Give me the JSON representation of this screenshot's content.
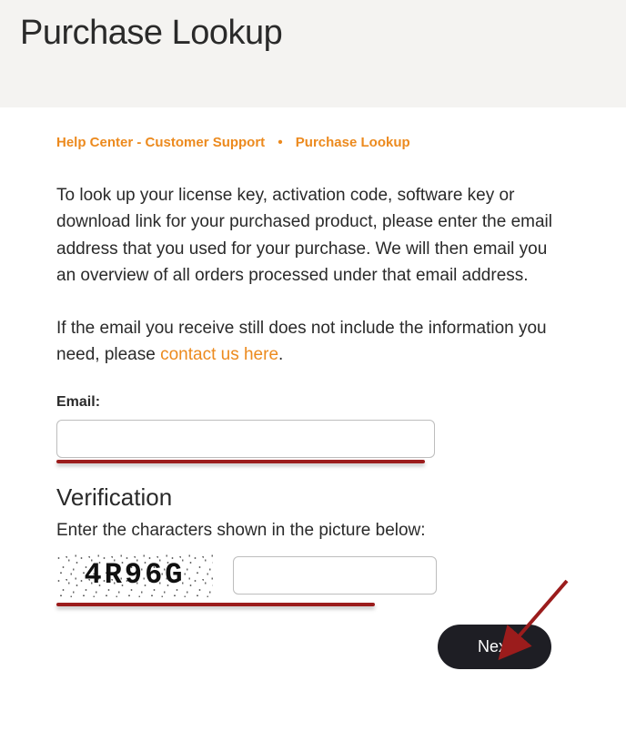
{
  "header": {
    "title": "Purchase Lookup"
  },
  "breadcrumb": {
    "items": [
      {
        "label": "Help Center - Customer Support"
      },
      {
        "label": "Purchase Lookup"
      }
    ],
    "separator": "•"
  },
  "intro": {
    "p1": "To look up your license key, activation code, software key or download link for your purchased product, please enter the email address that you used for your purchase. We will then email you an overview of all orders processed under that email address.",
    "p2a": "If the email you receive still does not include the information you need, please ",
    "p2_link": "contact us here",
    "p2b": "."
  },
  "form": {
    "email_label": "Email:",
    "email_value": "",
    "verification_title": "Verification",
    "verification_instruction": "Enter the characters shown in the picture below:",
    "captcha_text": "4R96G",
    "captcha_value": "",
    "next_label": "Next"
  },
  "annotations": {
    "underline_color": "#9b1c1c",
    "arrow_color": "#9b1c1c"
  }
}
